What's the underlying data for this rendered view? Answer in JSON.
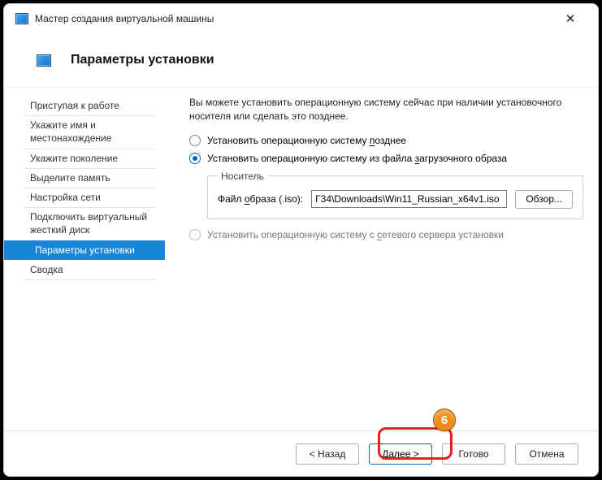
{
  "window": {
    "title": "Мастер создания виртуальной машины"
  },
  "page": {
    "title": "Параметры установки"
  },
  "sidebar": {
    "items": [
      {
        "label": "Приступая к работе"
      },
      {
        "label": "Укажите имя и местонахождение"
      },
      {
        "label": "Укажите поколение"
      },
      {
        "label": "Выделите память"
      },
      {
        "label": "Настройка сети"
      },
      {
        "label": "Подключить виртуальный жесткий диск"
      },
      {
        "label": "Параметры установки"
      },
      {
        "label": "Сводка"
      }
    ],
    "activeIndex": 6
  },
  "main": {
    "intro": "Вы можете установить операционную систему сейчас при наличии установочного носителя или сделать это позднее.",
    "opt_later_pre": "Установить операционную систему ",
    "opt_later_u": "п",
    "opt_later_post": "озднее",
    "opt_image_pre": "Установить операционную систему из файла ",
    "opt_image_u": "з",
    "opt_image_post": "агрузочного образа",
    "media_legend": "Носитель",
    "file_label_pre": "Файл ",
    "file_label_u": "о",
    "file_label_post": "браза (.iso):",
    "file_value": "Г34\\Downloads\\Win11_Russian_x64v1.iso",
    "browse": "Обзор...",
    "opt_network_pre": "Установить операционную систему с ",
    "opt_network_u": "с",
    "opt_network_post": "етевого сервера установки"
  },
  "footer": {
    "back": "< Назад",
    "next": "Далее >",
    "finish": "Готово",
    "cancel": "Отмена"
  },
  "annotation": {
    "badge": "6"
  }
}
